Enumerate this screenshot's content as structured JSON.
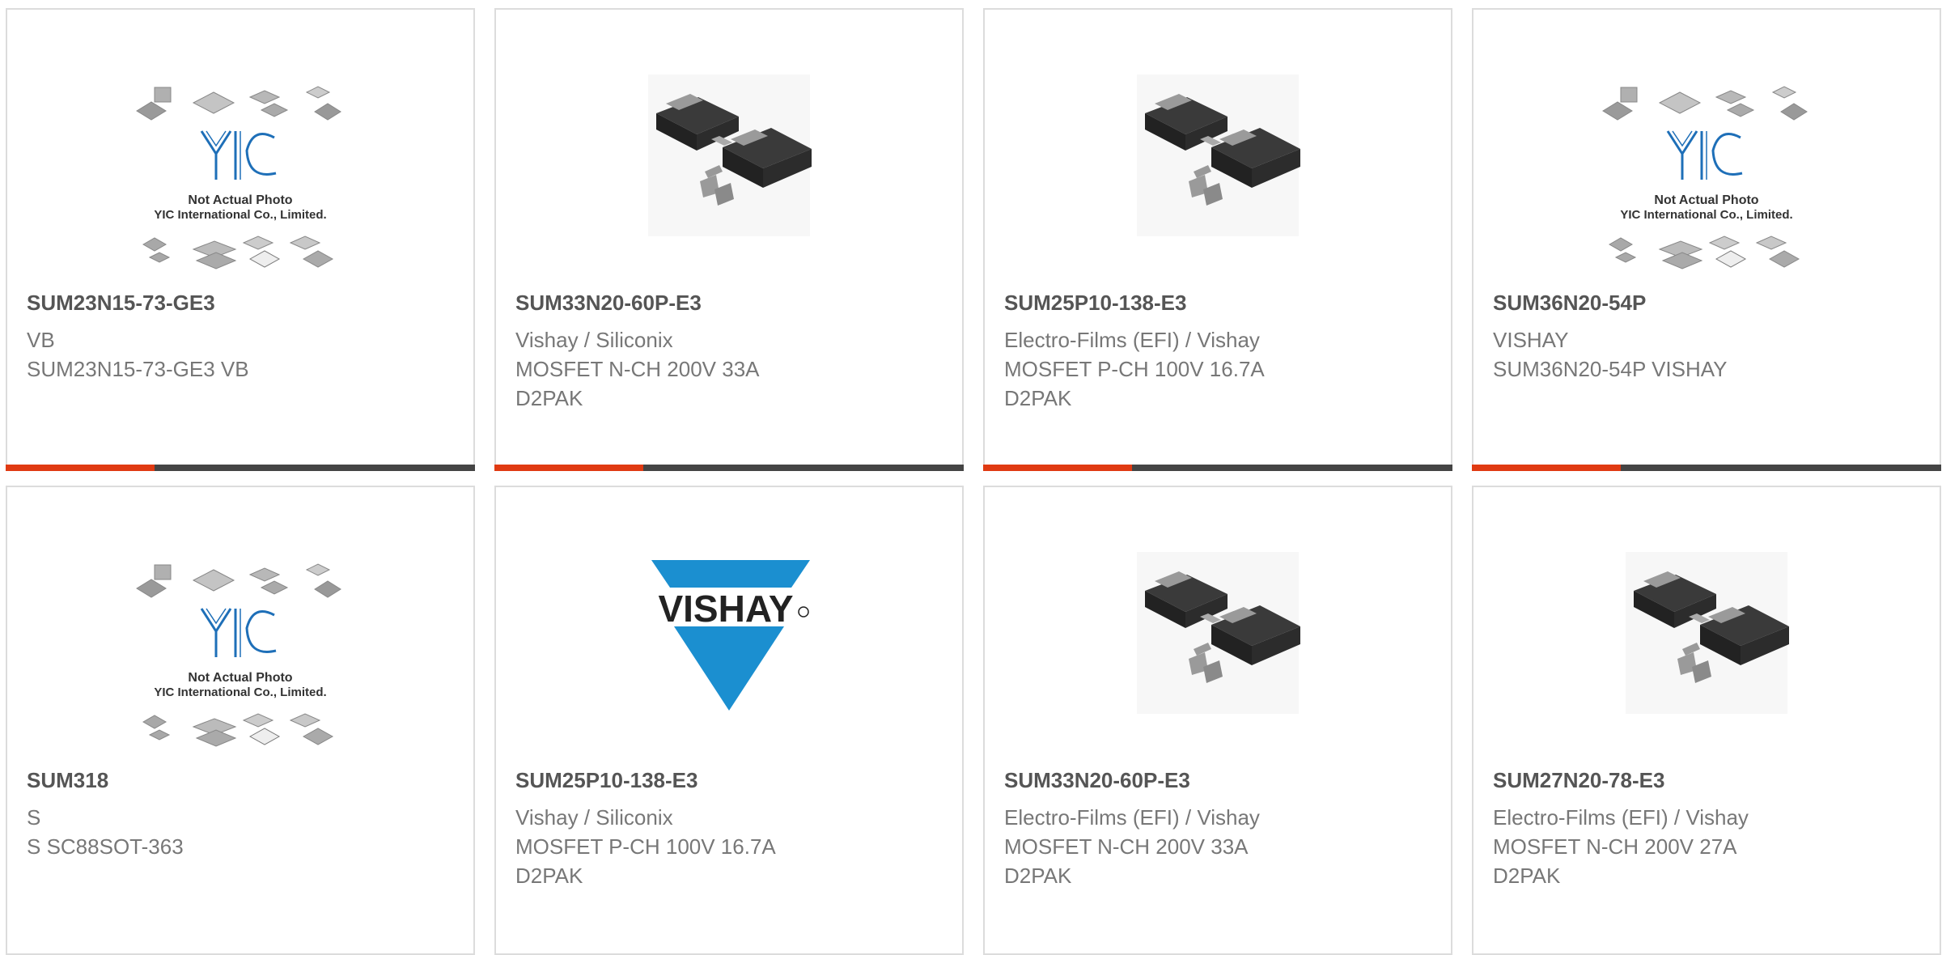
{
  "products": [
    {
      "title": "SUM23N15-73-GE3",
      "line1": "VB",
      "line2": "SUM23N15-73-GE3 VB",
      "line3": "",
      "image": "placeholder-photo",
      "placeholder_text1": "Not Actual Photo",
      "placeholder_text2": "YIC International Co., Limited."
    },
    {
      "title": "SUM33N20-60P-E3",
      "line1": "Vishay / Siliconix",
      "line2": "MOSFET N-CH 200V 33A",
      "line3": "D2PAK",
      "image": "d2pak-package"
    },
    {
      "title": "SUM25P10-138-E3",
      "line1": "Electro-Films (EFI) / Vishay",
      "line2": "MOSFET P-CH 100V 16.7A",
      "line3": "D2PAK",
      "image": "d2pak-package"
    },
    {
      "title": "SUM36N20-54P",
      "line1": "VISHAY",
      "line2": "SUM36N20-54P VISHAY",
      "line3": "",
      "image": "placeholder-photo",
      "placeholder_text1": "Not Actual Photo",
      "placeholder_text2": "YIC International Co., Limited."
    },
    {
      "title": "SUM318",
      "line1": "S",
      "line2": "S SC88SOT-363",
      "line3": "",
      "image": "placeholder-photo",
      "placeholder_text1": "Not Actual Photo",
      "placeholder_text2": "YIC International Co., Limited."
    },
    {
      "title": "SUM25P10-138-E3",
      "line1": "Vishay / Siliconix",
      "line2": "MOSFET P-CH 100V 16.7A",
      "line3": "D2PAK",
      "image": "vishay-logo",
      "logo_text": "VISHAY"
    },
    {
      "title": "SUM33N20-60P-E3",
      "line1": "Electro-Films (EFI) / Vishay",
      "line2": "MOSFET N-CH 200V 33A",
      "line3": "D2PAK",
      "image": "d2pak-package"
    },
    {
      "title": "SUM27N20-78-E3",
      "line1": "Electro-Films (EFI) / Vishay",
      "line2": "MOSFET N-CH 200V 27A",
      "line3": "D2PAK",
      "image": "d2pak-package"
    }
  ],
  "colors": {
    "accent": "#e03a12",
    "bar": "#444444",
    "border": "#dcdcdc",
    "yic_blue": "#1e6fb8",
    "vishay_blue": "#1b8fd0"
  }
}
